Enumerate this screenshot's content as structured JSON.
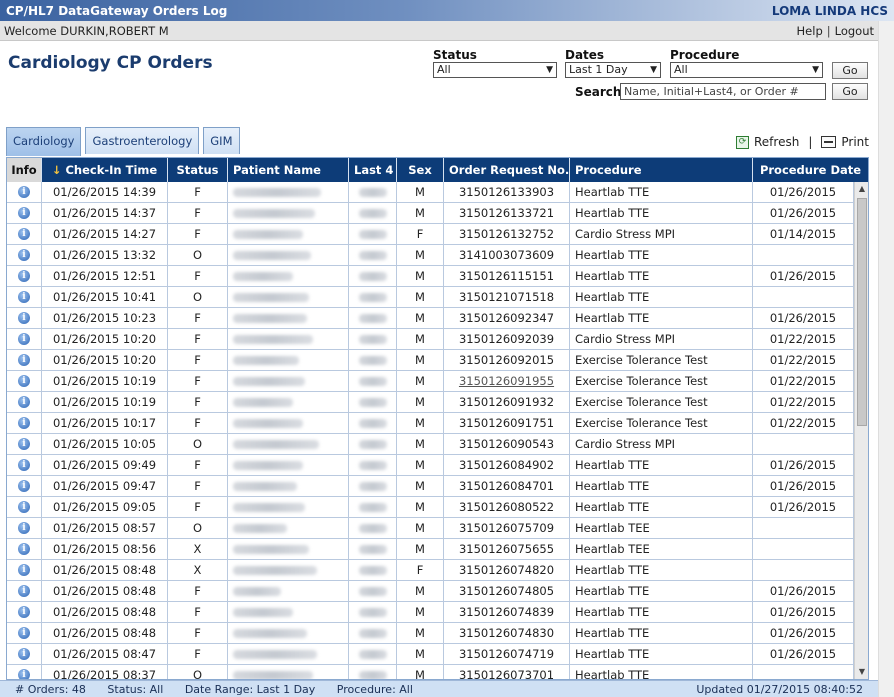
{
  "window": {
    "title": "CP/HL7 DataGateway Orders Log",
    "org": "LOMA LINDA HCS"
  },
  "welcome": {
    "text": "Welcome DURKIN,ROBERT M",
    "help": "Help",
    "logout": "Logout"
  },
  "page_title": "Cardiology CP Orders",
  "filters": {
    "status_label": "Status",
    "status_value": "All",
    "dates_label": "Dates",
    "dates_value": "Last 1 Day",
    "procedure_label": "Procedure",
    "procedure_value": "All",
    "go_label": "Go",
    "search_label": "Search",
    "search_placeholder": "Name, Initial+Last4, or Order #"
  },
  "tabs": [
    {
      "label": "Cardiology",
      "active": true
    },
    {
      "label": "Gastroenterology",
      "active": false
    },
    {
      "label": "GIM",
      "active": false
    }
  ],
  "tools": {
    "refresh": "Refresh",
    "print": "Print"
  },
  "grid": {
    "columns": [
      "Info",
      "Check-In Time",
      "Status",
      "Patient Name",
      "Last 4",
      "Sex",
      "Order Request No.",
      "Procedure",
      "Procedure Date"
    ],
    "sort_indicator": "↓",
    "rows": [
      {
        "time": "01/26/2015 14:39",
        "status": "F",
        "sex": "M",
        "order": "3150126133903",
        "procedure": "Heartlab TTE",
        "pdate": "01/26/2015"
      },
      {
        "time": "01/26/2015 14:37",
        "status": "F",
        "sex": "M",
        "order": "3150126133721",
        "procedure": "Heartlab TTE",
        "pdate": "01/26/2015"
      },
      {
        "time": "01/26/2015 14:27",
        "status": "F",
        "sex": "F",
        "order": "3150126132752",
        "procedure": "Cardio Stress MPI",
        "pdate": "01/14/2015"
      },
      {
        "time": "01/26/2015 13:32",
        "status": "O",
        "sex": "M",
        "order": "3141003073609",
        "procedure": "Heartlab TTE",
        "pdate": ""
      },
      {
        "time": "01/26/2015 12:51",
        "status": "F",
        "sex": "M",
        "order": "3150126115151",
        "procedure": "Heartlab TTE",
        "pdate": "01/26/2015"
      },
      {
        "time": "01/26/2015 10:41",
        "status": "O",
        "sex": "M",
        "order": "3150121071518",
        "procedure": "Heartlab TTE",
        "pdate": ""
      },
      {
        "time": "01/26/2015 10:23",
        "status": "F",
        "sex": "M",
        "order": "3150126092347",
        "procedure": "Heartlab TTE",
        "pdate": "01/26/2015"
      },
      {
        "time": "01/26/2015 10:20",
        "status": "F",
        "sex": "M",
        "order": "3150126092039",
        "procedure": "Cardio Stress MPI",
        "pdate": "01/22/2015"
      },
      {
        "time": "01/26/2015 10:20",
        "status": "F",
        "sex": "M",
        "order": "3150126092015",
        "procedure": "Exercise Tolerance Test",
        "pdate": "01/22/2015"
      },
      {
        "time": "01/26/2015 10:19",
        "status": "F",
        "sex": "M",
        "order": "3150126091955",
        "procedure": "Exercise Tolerance Test",
        "pdate": "01/22/2015",
        "link": true
      },
      {
        "time": "01/26/2015 10:19",
        "status": "F",
        "sex": "M",
        "order": "3150126091932",
        "procedure": "Exercise Tolerance Test",
        "pdate": "01/22/2015"
      },
      {
        "time": "01/26/2015 10:17",
        "status": "F",
        "sex": "M",
        "order": "3150126091751",
        "procedure": "Exercise Tolerance Test",
        "pdate": "01/22/2015"
      },
      {
        "time": "01/26/2015 10:05",
        "status": "O",
        "sex": "M",
        "order": "3150126090543",
        "procedure": "Cardio Stress MPI",
        "pdate": ""
      },
      {
        "time": "01/26/2015 09:49",
        "status": "F",
        "sex": "M",
        "order": "3150126084902",
        "procedure": "Heartlab TTE",
        "pdate": "01/26/2015"
      },
      {
        "time": "01/26/2015 09:47",
        "status": "F",
        "sex": "M",
        "order": "3150126084701",
        "procedure": "Heartlab TTE",
        "pdate": "01/26/2015"
      },
      {
        "time": "01/26/2015 09:05",
        "status": "F",
        "sex": "M",
        "order": "3150126080522",
        "procedure": "Heartlab TTE",
        "pdate": "01/26/2015"
      },
      {
        "time": "01/26/2015 08:57",
        "status": "O",
        "sex": "M",
        "order": "3150126075709",
        "procedure": "Heartlab TEE",
        "pdate": ""
      },
      {
        "time": "01/26/2015 08:56",
        "status": "X",
        "sex": "M",
        "order": "3150126075655",
        "procedure": "Heartlab TEE",
        "pdate": ""
      },
      {
        "time": "01/26/2015 08:48",
        "status": "X",
        "sex": "F",
        "order": "3150126074820",
        "procedure": "Heartlab TTE",
        "pdate": ""
      },
      {
        "time": "01/26/2015 08:48",
        "status": "F",
        "sex": "M",
        "order": "3150126074805",
        "procedure": "Heartlab TTE",
        "pdate": "01/26/2015"
      },
      {
        "time": "01/26/2015 08:48",
        "status": "F",
        "sex": "M",
        "order": "3150126074839",
        "procedure": "Heartlab TTE",
        "pdate": "01/26/2015"
      },
      {
        "time": "01/26/2015 08:48",
        "status": "F",
        "sex": "M",
        "order": "3150126074830",
        "procedure": "Heartlab TTE",
        "pdate": "01/26/2015"
      },
      {
        "time": "01/26/2015 08:47",
        "status": "F",
        "sex": "M",
        "order": "3150126074719",
        "procedure": "Heartlab TTE",
        "pdate": "01/26/2015"
      },
      {
        "time": "01/26/2015 08:37",
        "status": "O",
        "sex": "M",
        "order": "3150126073701",
        "procedure": "Heartlab TTE",
        "pdate": ""
      }
    ]
  },
  "statusbar": {
    "orders": "# Orders: 48",
    "status": "Status: All",
    "date_range": "Date Range: Last 1 Day",
    "procedure": "Procedure: All",
    "updated": "Updated 01/27/2015 08:40:52"
  },
  "colors": {
    "header_bg": "#0d3c78",
    "title": "#1b3c6e",
    "tab_active": "#9fc0e8"
  }
}
